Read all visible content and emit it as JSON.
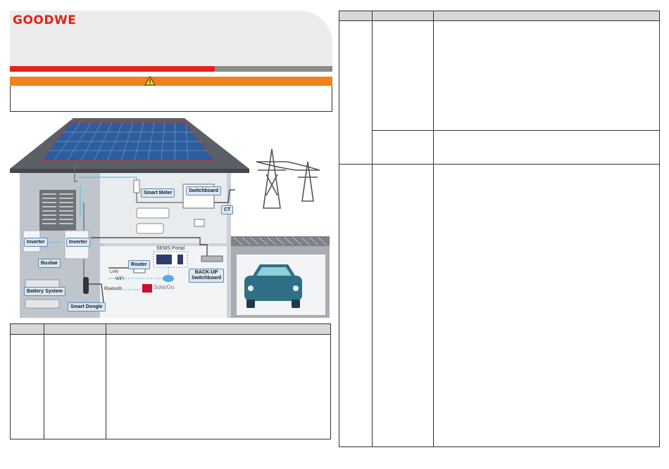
{
  "header": {
    "logo": "GOODWE"
  },
  "warning": {
    "icon": "warning-triangle-icon"
  },
  "diagram": {
    "labels": {
      "smart_meter": "Smart Meter",
      "switchboard": "Switchboard",
      "ct": "CT",
      "inverter_left": "Inverter",
      "inverter_right": "Inverter",
      "busbar": "Busbar",
      "battery_system": "Battery System",
      "smart_dongle": "Smart Dongle",
      "router": "Router",
      "sems_portal": "SEMS Portal",
      "backup_switchboard_1": "BACK-UP",
      "backup_switchboard_2": "Switchboard",
      "lan": "LAN",
      "wifi": "WiFi",
      "bluetooth": "Bluetooth",
      "solargo": "SolarGo"
    }
  },
  "colors": {
    "brand_red": "#e2231a",
    "warning_orange": "#f0821e",
    "header_gray": "#d8d8d8"
  }
}
